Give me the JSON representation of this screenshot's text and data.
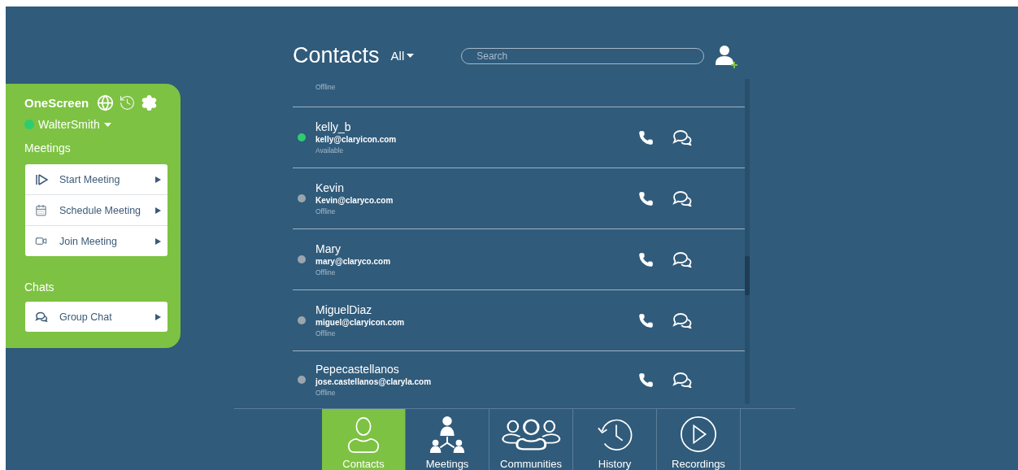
{
  "sidebar": {
    "app_name": "OneScreen",
    "user": {
      "name": "WalterSmith",
      "online": true
    },
    "sections": [
      {
        "title": "Meetings",
        "items": [
          {
            "label": "Start Meeting",
            "kind": "start"
          },
          {
            "label": "Schedule Meeting",
            "kind": "schedule"
          },
          {
            "label": "Join Meeting",
            "kind": "join"
          }
        ]
      },
      {
        "title": "Chats",
        "items": [
          {
            "label": "Group Chat",
            "kind": "chat"
          }
        ]
      }
    ]
  },
  "contacts": {
    "title": "Contacts",
    "filter": "All",
    "search": {
      "placeholder": "Search"
    },
    "rows": [
      {
        "kind": "partial",
        "status": "Offline"
      },
      {
        "kind": "full",
        "name": "kelly_b",
        "email": "kelly@claryicon.com",
        "status": "Available",
        "online": true
      },
      {
        "kind": "full",
        "name": "Kevin",
        "email": "Kevin@claryco.com",
        "status": "Offline",
        "online": false
      },
      {
        "kind": "full",
        "name": "Mary",
        "email": "mary@claryco.com",
        "status": "Offline",
        "online": false
      },
      {
        "kind": "full",
        "name": "MiguelDiaz",
        "email": "miguel@claryicon.com",
        "status": "Offline",
        "online": false
      },
      {
        "kind": "full",
        "name": "Pepecastellanos",
        "email": "jose.castellanos@claryla.com",
        "status": "Offline",
        "online": false
      }
    ]
  },
  "nav": [
    {
      "label": "Contacts",
      "kind": "contacts",
      "selected": true
    },
    {
      "label": "Meetings",
      "kind": "meetings",
      "selected": false
    },
    {
      "label": "Communities",
      "kind": "communities",
      "selected": false
    },
    {
      "label": "History",
      "kind": "history",
      "selected": false
    },
    {
      "label": "Recordings",
      "kind": "recordings",
      "selected": false
    }
  ]
}
